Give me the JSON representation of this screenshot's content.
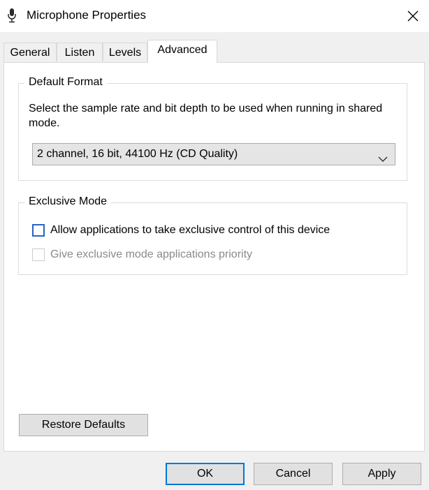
{
  "window": {
    "title": "Microphone Properties",
    "icon": "microphone-icon"
  },
  "tabs": [
    {
      "label": "General",
      "active": false
    },
    {
      "label": "Listen",
      "active": false
    },
    {
      "label": "Levels",
      "active": false
    },
    {
      "label": "Advanced",
      "active": true
    }
  ],
  "default_format": {
    "legend": "Default Format",
    "description": "Select the sample rate and bit depth to be used when running in shared mode.",
    "selected": "2 channel, 16 bit, 44100 Hz (CD Quality)"
  },
  "exclusive_mode": {
    "legend": "Exclusive Mode",
    "allow_label": "Allow applications to take exclusive control of this device",
    "allow_checked": false,
    "priority_label": "Give exclusive mode applications priority",
    "priority_checked": false,
    "priority_enabled": false
  },
  "buttons": {
    "restore_defaults": "Restore Defaults",
    "ok": "OK",
    "cancel": "Cancel",
    "apply": "Apply"
  },
  "colors": {
    "focus_blue": "#0078d7",
    "window_bg": "#f0f0f0"
  }
}
